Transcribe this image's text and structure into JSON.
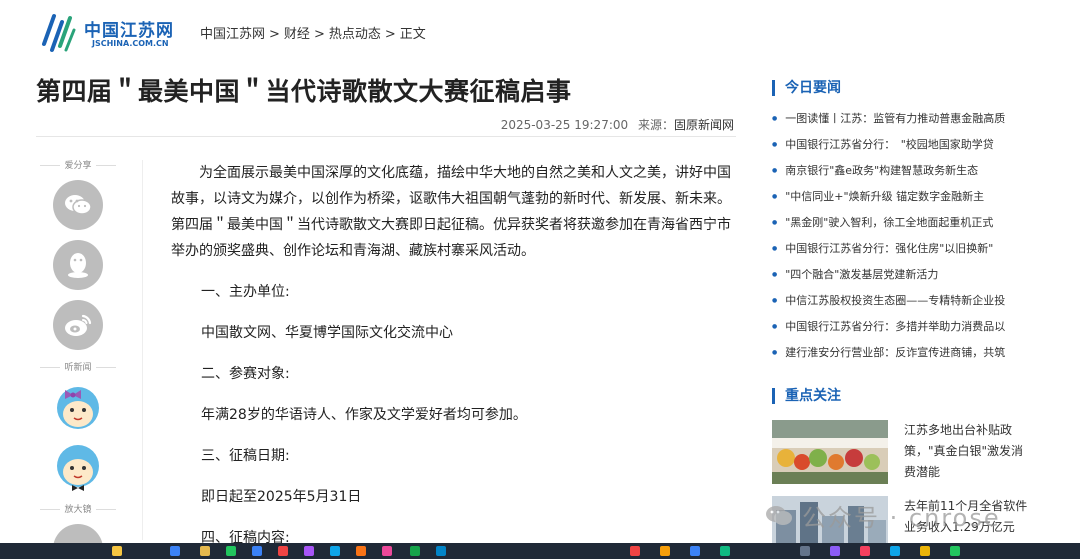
{
  "site": {
    "logo_cn": "中国江苏网",
    "logo_en": "JSCHINA.COM.CN"
  },
  "breadcrumb": [
    "中国江苏网",
    ">",
    "财经",
    ">",
    "热点动态",
    ">",
    "正文"
  ],
  "article": {
    "title": "第四届＂最美中国＂当代诗歌散文大赛征稿启事",
    "datetime": "2025-03-25 19:27:00",
    "source_label": "来源：",
    "source_name": "固原新闻网",
    "paragraphs": [
      "为全面展示最美中国深厚的文化底蕴，描绘中华大地的自然之美和人文之美，讲好中国故事，以诗文为媒介，以创作为桥梁，讴歌伟大祖国朝气蓬勃的新时代、新发展、新未来。第四届＂最美中国＂当代诗歌散文大赛即日起征稿。优异获奖者将获邀参加在青海省西宁市举办的颁奖盛典、创作论坛和青海湖、藏族村寨采风活动。",
      "一、主办单位:",
      "中国散文网、华夏博学国际文化交流中心",
      "二、参赛对象:",
      "年满28岁的华语诗人、作家及文学爱好者均可参加。",
      "三、征稿日期:",
      "即日起至2025年5月31日",
      "四、征稿内容:"
    ]
  },
  "share": {
    "share_label": "爱分享",
    "listen_label": "听新闻",
    "zoom_label": "放大镜",
    "icons": [
      "wechat-icon",
      "qq-icon",
      "weibo-icon"
    ]
  },
  "sidebar": {
    "today_title": "今日要闻",
    "today_items": [
      "一图读懂丨江苏：监管有力推动普惠金融高质",
      "中国银行江苏省分行：　\"校园地国家助学贷",
      "南京银行\"鑫e政务\"构建智慧政务新生态",
      "\"中信同业+\"焕新升级 锚定数字金融新主",
      "\"黑金刚\"驶入智利，徐工全地面起重机正式",
      "中国银行江苏省分行：强化住房\"以旧换新\"",
      "\"四个融合\"激发基层党建新活力",
      "中信江苏股权投资生态圈——专精特新企业投",
      "中国银行江苏省分行：多措并举助力消费品以",
      "建行淮安分行营业部：反诈宣传进商铺，共筑"
    ],
    "focus_title": "重点关注",
    "focus_items": [
      "江苏多地出台补贴政策，\"真金白银\"激发消费潜能",
      "去年前11个月全省软件业务收入1.29万亿元"
    ]
  },
  "watermark": {
    "text": "公众号 · cnrose"
  },
  "colors": {
    "brand": "#1b63b5",
    "share_gray": "#bdbdbd",
    "taskbar": "#1f2937"
  }
}
